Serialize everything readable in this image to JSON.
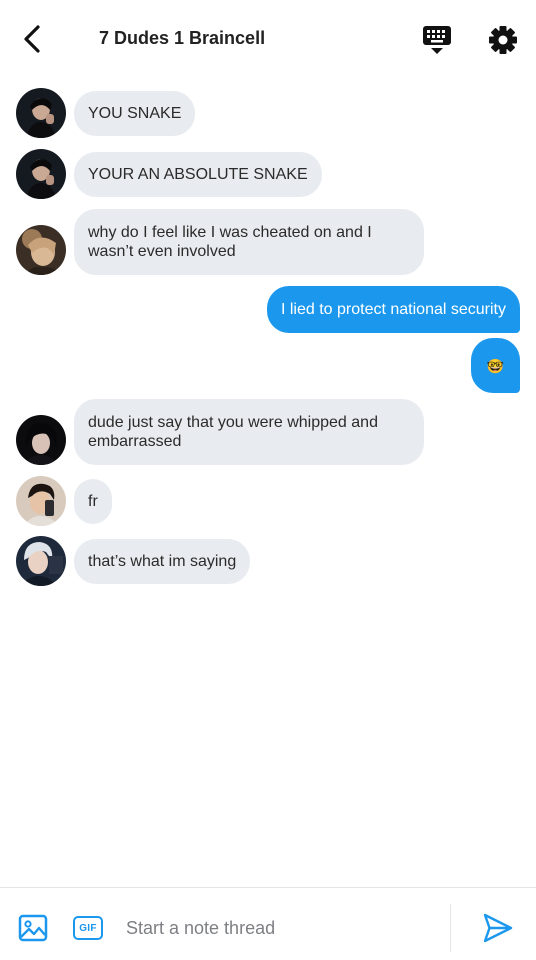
{
  "header": {
    "title": "7 Dudes 1 Braincell",
    "icons": [
      "chevron-left-icon",
      "keyboard-icon",
      "gear-icon"
    ]
  },
  "messages": [
    {
      "direction": "incoming",
      "avatar": "avatar-1",
      "text": "YOU SNAKE"
    },
    {
      "direction": "incoming",
      "avatar": "avatar-1",
      "text": "YOUR AN ABSOLUTE SNAKE"
    },
    {
      "direction": "incoming",
      "avatar": "avatar-2",
      "text": "why do I feel like I was cheated on and I wasn’t even involved"
    },
    {
      "direction": "outgoing",
      "text": "I lied to protect national security"
    },
    {
      "direction": "outgoing",
      "emoji": "🤓"
    },
    {
      "direction": "incoming",
      "avatar": "avatar-3",
      "text": "dude just say that you were whipped and embarrassed"
    },
    {
      "direction": "incoming",
      "avatar": "avatar-4",
      "text": "fr"
    },
    {
      "direction": "incoming",
      "avatar": "avatar-5",
      "text": "that’s what im saying"
    }
  ],
  "composer": {
    "placeholder": "Start a note thread",
    "gif_label": "GIF",
    "icons": [
      "image-icon",
      "gif-icon",
      "send-icon"
    ]
  },
  "colors": {
    "accent": "#1b98ee",
    "incoming_bubble": "#e8ebef",
    "outgoing_text": "#ffffff"
  }
}
